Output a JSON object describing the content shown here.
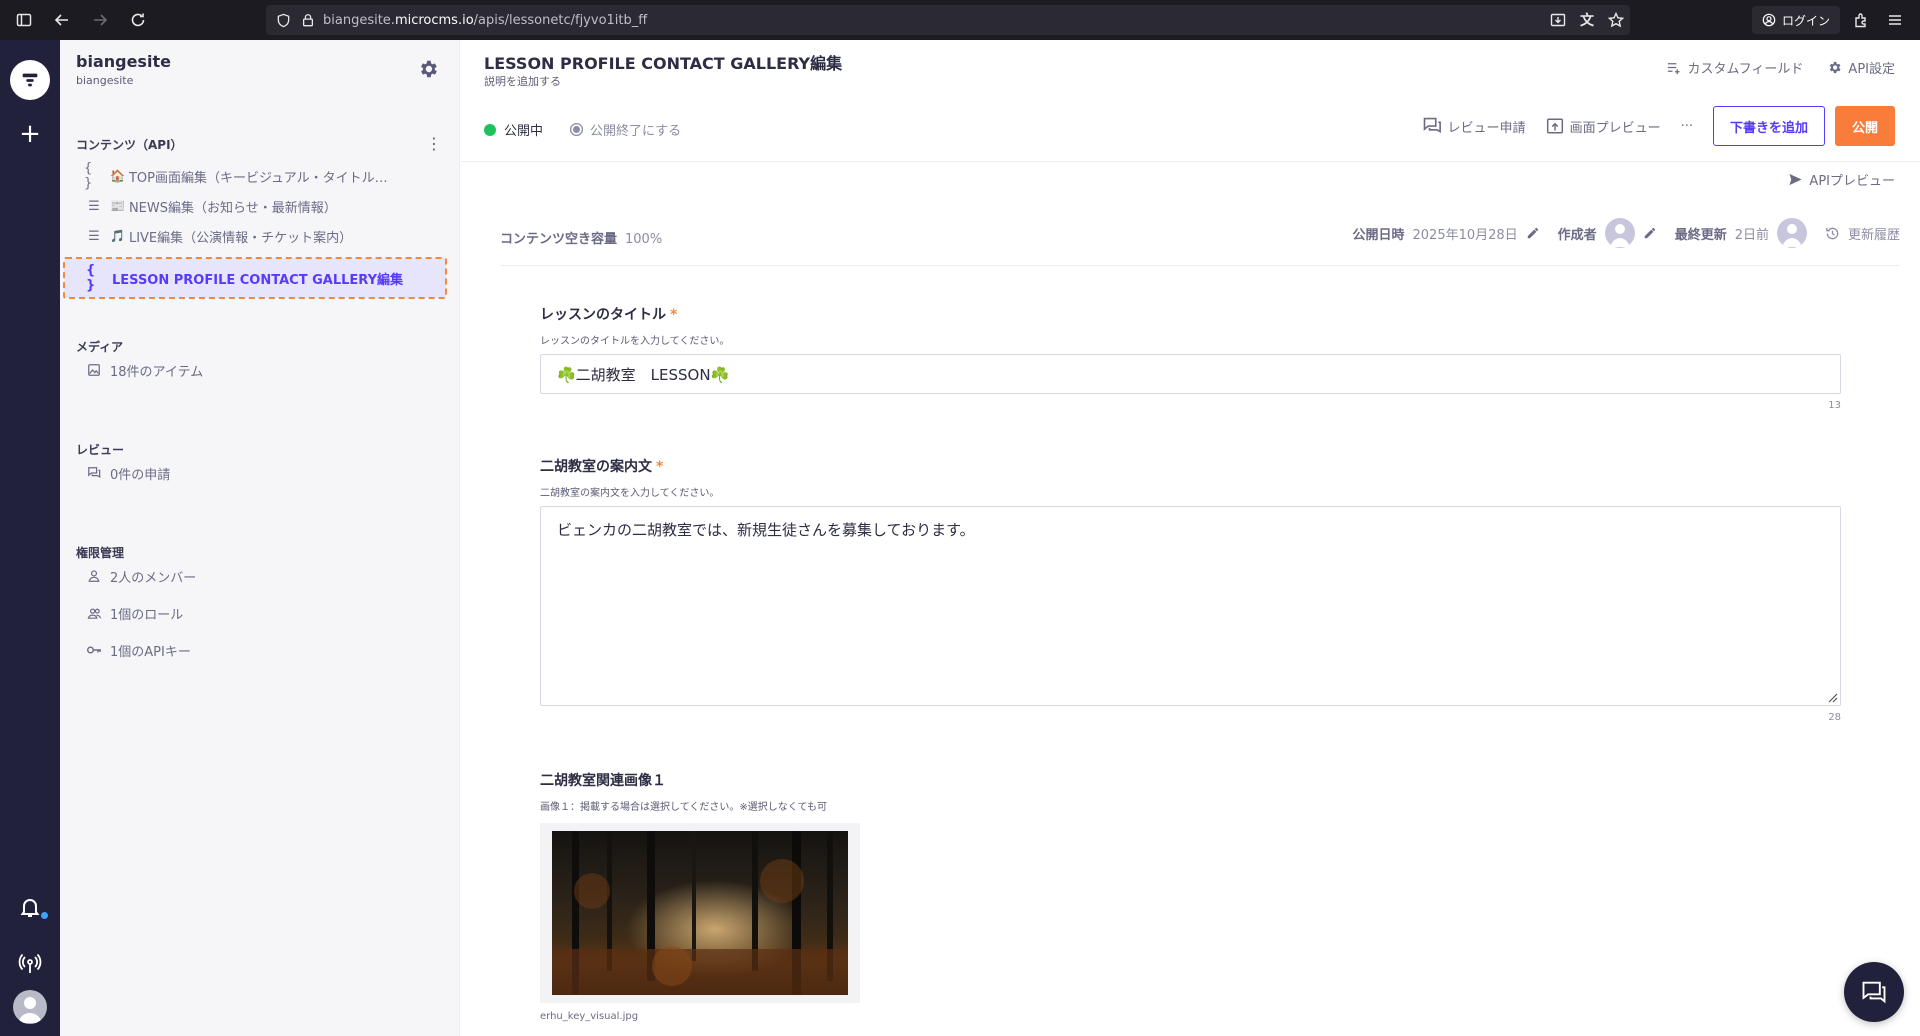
{
  "browser": {
    "url_prefix": "biangesite.",
    "url_domain": "microcms.io",
    "url_path": "/apis/lessonetc/fjyvo1itb_ff",
    "login_label": "ログイン"
  },
  "sidebar": {
    "service_name": "biangesite",
    "service_id": "biangesite",
    "content_section": "コンテンツ（API）",
    "apis": [
      {
        "label": "TOP画面編集（キービジュアル・タイトル…",
        "emoji": "🏠",
        "type": "object"
      },
      {
        "label": "NEWS編集（お知らせ・最新情報）",
        "emoji": "📰",
        "type": "list"
      },
      {
        "label": "LIVE編集（公演情報・チケット案内）",
        "emoji": "🎵",
        "type": "list"
      },
      {
        "label": "LESSON PROFILE CONTACT GALLERY編集",
        "emoji": "",
        "type": "object"
      }
    ],
    "media_section": "メディア",
    "media_item": "18件のアイテム",
    "review_section": "レビュー",
    "review_item": "0件の申請",
    "permission_section": "権限管理",
    "members_item": "2人のメンバー",
    "roles_item": "1個のロール",
    "apikeys_item": "1個のAPIキー"
  },
  "header": {
    "title": "LESSON PROFILE CONTACT GALLERY編集",
    "description_link": "説明を追加する",
    "custom_field_link": "カスタムフィールド",
    "api_settings_link": "API設定"
  },
  "status": {
    "published": "公開中",
    "end_publish": "公開終了にする"
  },
  "actions": {
    "review_request": "レビュー申請",
    "screen_preview": "画面プレビュー",
    "more": "···",
    "add_draft": "下書きを追加",
    "publish": "公開",
    "api_preview": "APIプレビュー"
  },
  "meta": {
    "capacity_label": "コンテンツ空き容量",
    "capacity_value": "100%",
    "published_at_label": "公開日時",
    "published_at_value": "2025年10月28日",
    "author_label": "作成者",
    "updated_label": "最終更新",
    "updated_value": "2日前",
    "history_link": "更新履歴"
  },
  "fields": {
    "title": {
      "label": "レッスンのタイトル",
      "required": "*",
      "hint": "レッスンのタイトルを入力してください。",
      "value": "☘️二胡教室　LESSON☘️",
      "count": "13"
    },
    "intro": {
      "label": "二胡教室の案内文",
      "required": "*",
      "hint": "二胡教室の案内文を入力してください。",
      "value": "ビェンカの二胡教室では、新規生徒さんを募集しております。",
      "count": "28"
    },
    "image1": {
      "label": "二胡教室関連画像１",
      "hint": "画像１：掲載する場合は選択してください。※選択しなくても可",
      "filename": "erhu_key_visual.jpg"
    }
  },
  "colors": {
    "accent": "#563bff",
    "publish": "#f87d3a",
    "status_green": "#1fc15a",
    "rail": "#21213b"
  }
}
